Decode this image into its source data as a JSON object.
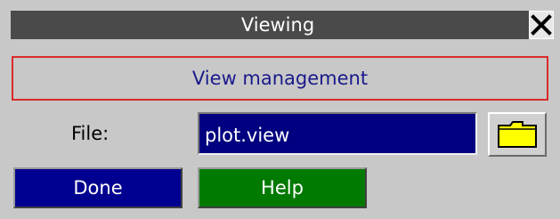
{
  "window": {
    "title": "Viewing",
    "close_glyph": "X"
  },
  "section": {
    "title": "View management"
  },
  "file": {
    "label": "File:",
    "value": "plot.view",
    "browse_icon": "folder-icon"
  },
  "buttons": {
    "done": "Done",
    "help": "Help"
  },
  "colors": {
    "title_bar": "#4a4a4a",
    "section_border": "#d92a2a",
    "section_text": "#1a1a8c",
    "input_bg": "#000080",
    "done_bg": "#000090",
    "help_bg": "#007a00",
    "folder": "#ffff00"
  }
}
